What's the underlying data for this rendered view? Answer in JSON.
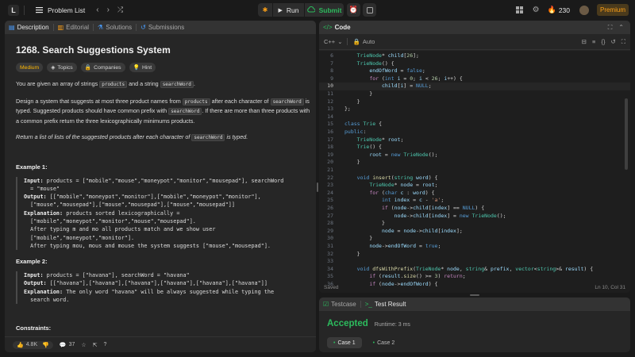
{
  "topbar": {
    "logo_letter": "L",
    "problem_list": "Problem List",
    "run_label": "Run",
    "submit_label": "Submit",
    "streak_count": "230",
    "premium_label": "Premium"
  },
  "description_panel": {
    "tabs": [
      {
        "label": "Description",
        "icon": "document-icon",
        "active": true
      },
      {
        "label": "Editorial",
        "icon": "book-icon",
        "active": false
      },
      {
        "label": "Solutions",
        "icon": "flask-icon",
        "active": false
      },
      {
        "label": "Submissions",
        "icon": "history-icon",
        "active": false
      }
    ],
    "title": "1268. Search Suggestions System",
    "chips": [
      "Medium",
      "Topics",
      "Companies",
      "Hint"
    ],
    "intro_pre": "You are given an array of strings",
    "intro_code1": "products",
    "intro_mid": "and a string",
    "intro_code2": "searchWord",
    "intro_end": ".",
    "para2_a": "Design a system that suggests at most three product names from",
    "para2_code1": "products",
    "para2_b": "after each character of",
    "para2_code2": "searchWord",
    "para2_c": "is typed. Suggested products should have common prefix with",
    "para2_code3": "searchWord",
    "para2_d": ". If there are more than three products with a common prefix return the three lexicographically minimums products.",
    "para3_a": "Return a list of lists of the suggested products after each character of",
    "para3_code": "searchWord",
    "para3_b": "is typed.",
    "example1_heading": "Example 1:",
    "example1_lines": [
      [
        "Input:",
        " products = [\"mobile\",\"mouse\",\"moneypot\",\"monitor\",\"mousepad\"], searchWord"
      ],
      [
        "",
        "= \"mouse\""
      ],
      [
        "Output:",
        " [[\"mobile\",\"moneypot\",\"monitor\"],[\"mobile\",\"moneypot\",\"monitor\"],"
      ],
      [
        "",
        "[\"mouse\",\"mousepad\"],[\"mouse\",\"mousepad\"],[\"mouse\",\"mousepad\"]]"
      ],
      [
        "Explanation:",
        " products sorted lexicographically ="
      ],
      [
        "",
        "[\"mobile\",\"moneypot\",\"monitor\",\"mouse\",\"mousepad\"]."
      ],
      [
        "",
        "After typing m and mo all products match and we show user"
      ],
      [
        "",
        "[\"mobile\",\"moneypot\",\"monitor\"]."
      ],
      [
        "",
        "After typing mou, mous and mouse the system suggests [\"mouse\",\"mousepad\"]."
      ]
    ],
    "example2_heading": "Example 2:",
    "example2_lines": [
      [
        "Input:",
        " products = [\"havana\"], searchWord = \"havana\""
      ],
      [
        "Output:",
        " [[\"havana\"],[\"havana\"],[\"havana\"],[\"havana\"],[\"havana\"],[\"havana\"]]"
      ],
      [
        "Explanation:",
        " The only word \"havana\" will be always suggested while typing the"
      ],
      [
        "",
        "search word."
      ]
    ],
    "constraints_heading": "Constraints:",
    "footer": {
      "likes": "4.8K",
      "comments": "37"
    }
  },
  "code_panel": {
    "title": "Code",
    "language": "C++",
    "mode": "Auto",
    "lines": [
      {
        "n": "6",
        "t": "    TrieNode* child[26];"
      },
      {
        "n": "7",
        "t": "    TrieNode() {"
      },
      {
        "n": "8",
        "t": "        endOfWord = false;"
      },
      {
        "n": "9",
        "t": "        for (int i = 0; i < 26; i++) {"
      },
      {
        "n": "10",
        "t": "            child[i] = NULL;"
      },
      {
        "n": "11",
        "t": "        }"
      },
      {
        "n": "12",
        "t": "    }"
      },
      {
        "n": "13",
        "t": "};"
      },
      {
        "n": "14",
        "t": ""
      },
      {
        "n": "15",
        "t": "class Trie {"
      },
      {
        "n": "16",
        "t": "public:"
      },
      {
        "n": "17",
        "t": "    TrieNode* root;"
      },
      {
        "n": "18",
        "t": "    Trie() {"
      },
      {
        "n": "19",
        "t": "        root = new TrieNode();"
      },
      {
        "n": "20",
        "t": "    }"
      },
      {
        "n": "21",
        "t": ""
      },
      {
        "n": "22",
        "t": "    void insert(string word) {"
      },
      {
        "n": "23",
        "t": "        TrieNode* node = root;"
      },
      {
        "n": "24",
        "t": "        for (char c : word) {"
      },
      {
        "n": "25",
        "t": "            int index = c - 'a';"
      },
      {
        "n": "26",
        "t": "            if (node->child[index] == NULL) {"
      },
      {
        "n": "27",
        "t": "                node->child[index] = new TrieNode();"
      },
      {
        "n": "28",
        "t": "            }"
      },
      {
        "n": "29",
        "t": "            node = node->child[index];"
      },
      {
        "n": "30",
        "t": "        }"
      },
      {
        "n": "31",
        "t": "        node->endOfWord = true;"
      },
      {
        "n": "32",
        "t": "    }"
      },
      {
        "n": "33",
        "t": ""
      },
      {
        "n": "34",
        "t": "    void dfsWithPrefix(TrieNode* node, string& prefix, vector<string>& result) {"
      },
      {
        "n": "35",
        "t": "        if (result.size() >= 3) return;"
      },
      {
        "n": "36",
        "t": "        if (node->endOfWord) {"
      }
    ],
    "current_line": "10",
    "status_left": "Saved",
    "status_right": "Ln 10, Col 31"
  },
  "result_panel": {
    "tabs": [
      {
        "label": "Testcase",
        "icon": "checkbox-icon",
        "active": false
      },
      {
        "label": "Test Result",
        "icon": "terminal-icon",
        "active": true
      }
    ],
    "status": "Accepted",
    "runtime": "Runtime: 3 ms",
    "cases": [
      "Case 1",
      "Case 2"
    ],
    "accent": "#2cbb5d"
  }
}
